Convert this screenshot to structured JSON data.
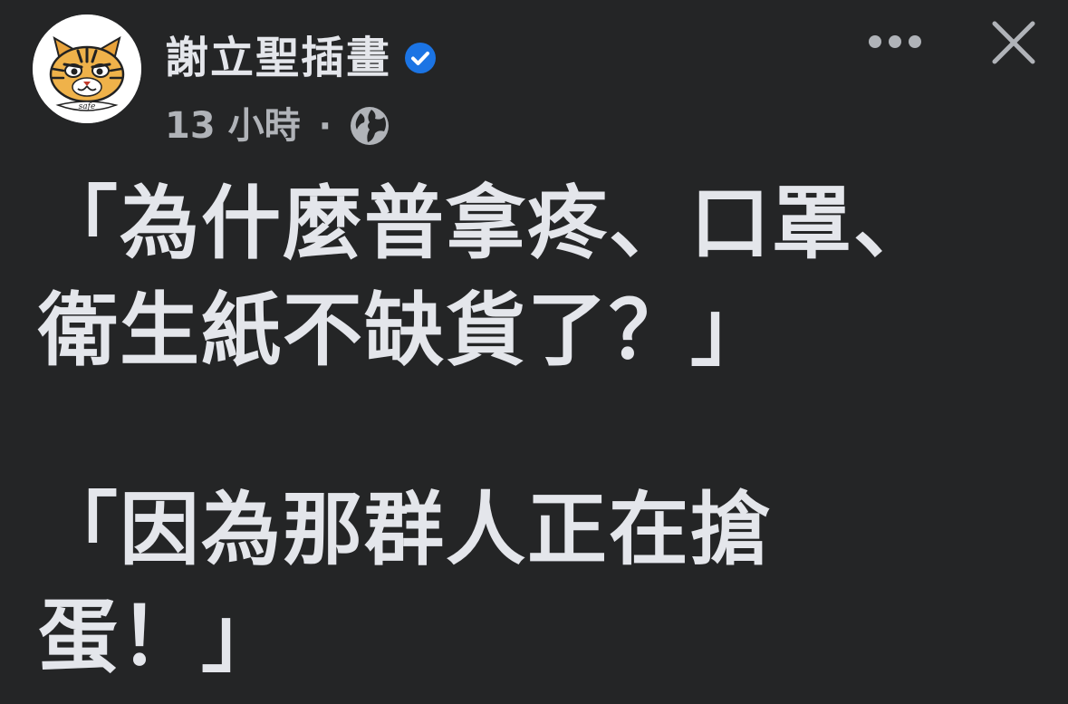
{
  "author": {
    "name": "謝立聖插畫",
    "avatar_logo_text": "safe",
    "verified_icon": "verified-badge-icon"
  },
  "meta": {
    "timestamp": "13 小時",
    "separator": "·",
    "privacy_icon": "globe-icon"
  },
  "actions": {
    "more_icon": "more-horizontal-icon",
    "close_icon": "close-icon"
  },
  "post": {
    "lines": [
      "「為什麼普拿疼、口罩、",
      "衛生紙不缺貨了？」",
      "「因為那群人正在搶",
      "蛋！」"
    ]
  },
  "colors": {
    "background": "#242526",
    "primary_text": "#e4e6eb",
    "secondary_text": "#b0b3b8",
    "verified_blue": "#1b74e4"
  }
}
